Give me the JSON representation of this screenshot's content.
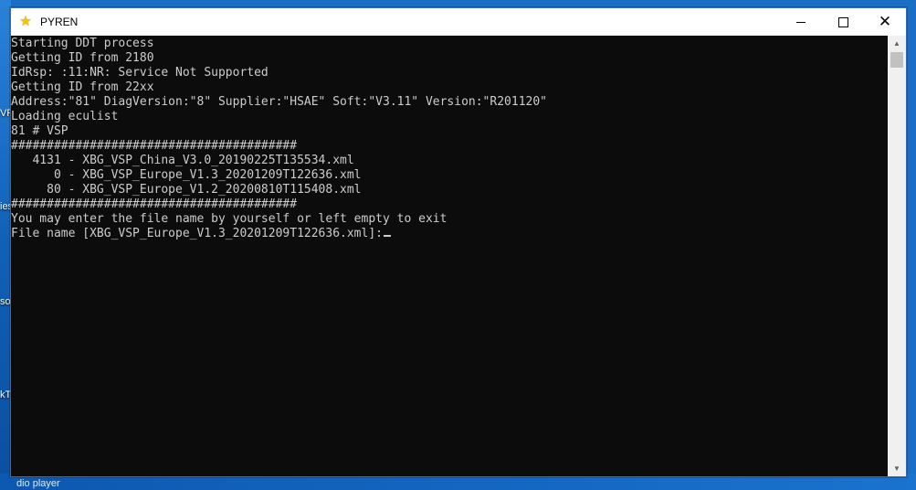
{
  "window": {
    "title": "PYREN",
    "icon": "star-icon",
    "controls": {
      "minimize": "minimize-icon",
      "maximize": "maximize-icon",
      "close": "close-icon"
    }
  },
  "console": {
    "lines": [
      "Starting DDT process",
      "Getting ID from 2180",
      "IdRsp: :11:NR: Service Not Supported",
      "Getting ID from 22xx",
      "Address:\"81\" DiagVersion:\"8\" Supplier:\"HSAE\" Soft:\"V3.11\" Version:\"R201120\"",
      "Loading eculist",
      "81 # VSP",
      "########################################",
      "   4131 - XBG_VSP_China_V3.0_20190225T135534.xml",
      "      0 - XBG_VSP_Europe_V1.3_20201209T122636.xml",
      "     80 - XBG_VSP_Europe_V1.2_20200810T115408.xml",
      "########################################",
      "You may enter the file name by yourself or left empty to exit"
    ],
    "prompt": "File name [XBG_VSP_Europe_V1.3_20201209T122636.xml]:"
  },
  "desktop": {
    "fragments": [
      "VR",
      "ies",
      "so",
      "kT"
    ],
    "taskbar_text": "dio player"
  },
  "colors": {
    "console_bg": "#0c0c0c",
    "console_fg": "#cccccc",
    "titlebar_bg": "#ffffff",
    "icon_star": "#f4c400"
  }
}
